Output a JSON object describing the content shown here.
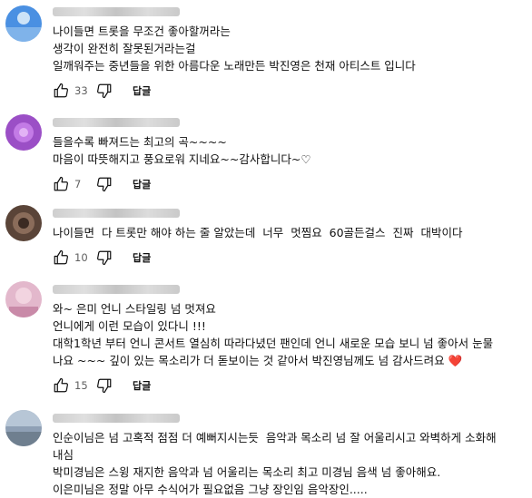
{
  "reply_label": "답글",
  "comments": [
    {
      "avatar_color": "#4a90e2",
      "lines": [
        "나이들면 트롯을 무조건 좋아할꺼라는",
        "생각이 완전히 잘못된거라는걸",
        "일깨워주는 중년들을 위한 아름다운 노래만든 박진영은 천재 아티스트 입니다"
      ],
      "likes": "33"
    },
    {
      "avatar_color": "#9b4fc6",
      "lines": [
        "들을수록 빠져드는 최고의 곡~~~~",
        "마음이 따뜻해지고 풍요로워 지네요~~감사합니다~♡"
      ],
      "likes": "7"
    },
    {
      "avatar_color": "#5a4438",
      "lines": [
        "나이들면  다 트롯만 해야 하는 줄 알았는데  너무  멋찜요  60골든걸스  진짜  대박이다"
      ],
      "likes": "10"
    },
    {
      "avatar_color": "#e3b8cc",
      "lines": [
        "와~ 은미 언니 스타일링 넘 멋져요",
        "언니에게 이런 모습이 있다니 !!!",
        "대학1학년 부터 언니 콘서트 열심히 따라다녔던 팬인데 언니 새로운 모습 보니 넘 좋아서 눈물",
        "나요 ~~~ 깊이 있는 목소리가 더 돋보이는 것 같아서 박진영님께도 넘 감사드려요"
      ],
      "heart": "❤️",
      "likes": "15"
    },
    {
      "avatar_color": "#8fa0b5",
      "lines": [
        "인순이님은 넘 고혹적 점점 더 예뻐지시는듯  음악과 목소리 넘 잘 어울리시고 와벽하게 소화해",
        "내심",
        "박미경님은 스윙 재지한 음악과 넘 어울리는 목소리 최고 미경님 음색 넘 좋아해요.",
        "이은미님은 정말 아무 수식어가 필요없음 그냥 장인임 음악장인....."
      ],
      "likes": ""
    }
  ]
}
